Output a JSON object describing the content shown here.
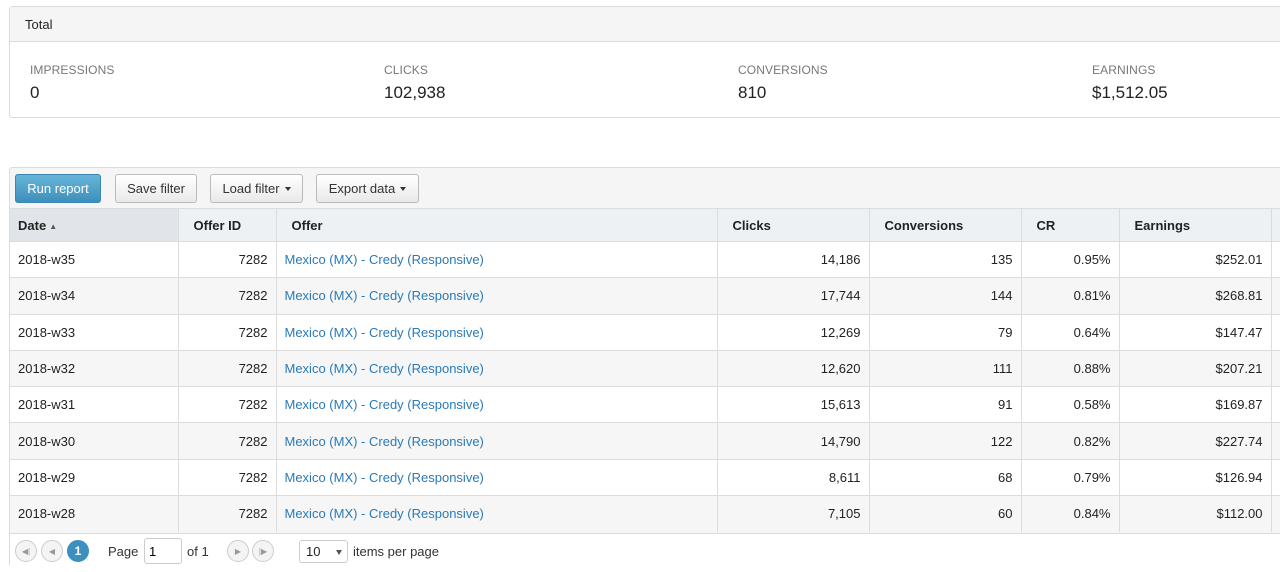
{
  "totals": {
    "title": "Total",
    "stats": [
      {
        "label": "IMPRESSIONS",
        "value": "0"
      },
      {
        "label": "CLICKS",
        "value": "102,938"
      },
      {
        "label": "CONVERSIONS",
        "value": "810"
      },
      {
        "label": "EARNINGS",
        "value": "$1,512.05"
      }
    ]
  },
  "toolbar": {
    "run_report": "Run report",
    "save_filter": "Save filter",
    "load_filter": "Load filter",
    "export_data": "Export data"
  },
  "table": {
    "columns": [
      "Date",
      "Offer ID",
      "Offer",
      "Clicks",
      "Conversions",
      "CR",
      "Earnings"
    ],
    "sort_indicator": "▲",
    "rows": [
      {
        "date": "2018-w35",
        "offer_id": "7282",
        "offer": "Mexico (MX) - Credy (Responsive)",
        "clicks": "14,186",
        "conversions": "135",
        "cr": "0.95%",
        "earnings": "$252.01"
      },
      {
        "date": "2018-w34",
        "offer_id": "7282",
        "offer": "Mexico (MX) - Credy (Responsive)",
        "clicks": "17,744",
        "conversions": "144",
        "cr": "0.81%",
        "earnings": "$268.81"
      },
      {
        "date": "2018-w33",
        "offer_id": "7282",
        "offer": "Mexico (MX) - Credy (Responsive)",
        "clicks": "12,269",
        "conversions": "79",
        "cr": "0.64%",
        "earnings": "$147.47"
      },
      {
        "date": "2018-w32",
        "offer_id": "7282",
        "offer": "Mexico (MX) - Credy (Responsive)",
        "clicks": "12,620",
        "conversions": "111",
        "cr": "0.88%",
        "earnings": "$207.21"
      },
      {
        "date": "2018-w31",
        "offer_id": "7282",
        "offer": "Mexico (MX) - Credy (Responsive)",
        "clicks": "15,613",
        "conversions": "91",
        "cr": "0.58%",
        "earnings": "$169.87"
      },
      {
        "date": "2018-w30",
        "offer_id": "7282",
        "offer": "Mexico (MX) - Credy (Responsive)",
        "clicks": "14,790",
        "conversions": "122",
        "cr": "0.82%",
        "earnings": "$227.74"
      },
      {
        "date": "2018-w29",
        "offer_id": "7282",
        "offer": "Mexico (MX) - Credy (Responsive)",
        "clicks": "8,611",
        "conversions": "68",
        "cr": "0.79%",
        "earnings": "$126.94"
      },
      {
        "date": "2018-w28",
        "offer_id": "7282",
        "offer": "Mexico (MX) - Credy (Responsive)",
        "clicks": "7,105",
        "conversions": "60",
        "cr": "0.84%",
        "earnings": "$112.00"
      }
    ]
  },
  "pager": {
    "current_page": "1",
    "page_label": "Page",
    "page_input_value": "1",
    "of_label": "of 1",
    "per_page_value": "10",
    "per_page_label": "items per page"
  }
}
